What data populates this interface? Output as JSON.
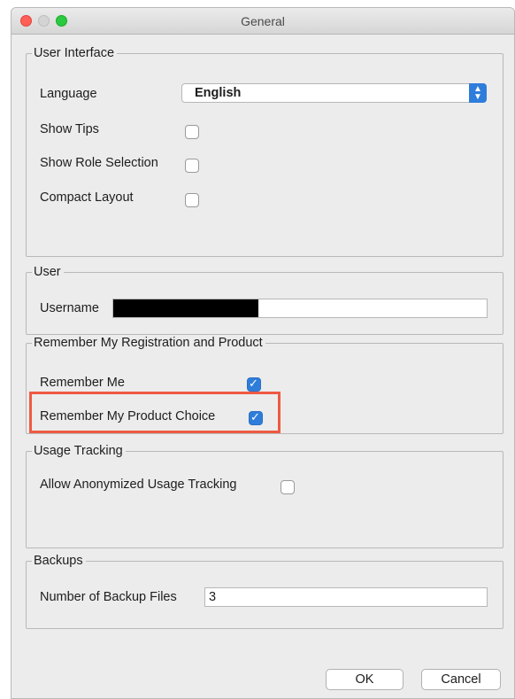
{
  "window": {
    "title": "General"
  },
  "user_interface": {
    "legend": "User Interface",
    "language_label": "Language",
    "language_value": "English",
    "show_tips_label": "Show Tips",
    "show_tips_checked": false,
    "show_role_label": "Show Role Selection",
    "show_role_checked": false,
    "compact_layout_label": "Compact Layout",
    "compact_layout_checked": false
  },
  "user": {
    "legend": "User",
    "username_label": "Username",
    "username_value": ""
  },
  "remember": {
    "legend": "Remember My Registration and Product",
    "remember_me_label": "Remember Me",
    "remember_me_checked": true,
    "remember_product_label": "Remember My Product Choice",
    "remember_product_checked": true
  },
  "usage": {
    "legend": "Usage Tracking",
    "allow_label": "Allow Anonymized Usage Tracking",
    "allow_checked": false
  },
  "backups": {
    "legend": "Backups",
    "number_label": "Number of Backup Files",
    "number_value": "3"
  },
  "buttons": {
    "ok": "OK",
    "cancel": "Cancel"
  },
  "colors": {
    "accent": "#2f7ddb",
    "highlight": "#ef5a42"
  }
}
